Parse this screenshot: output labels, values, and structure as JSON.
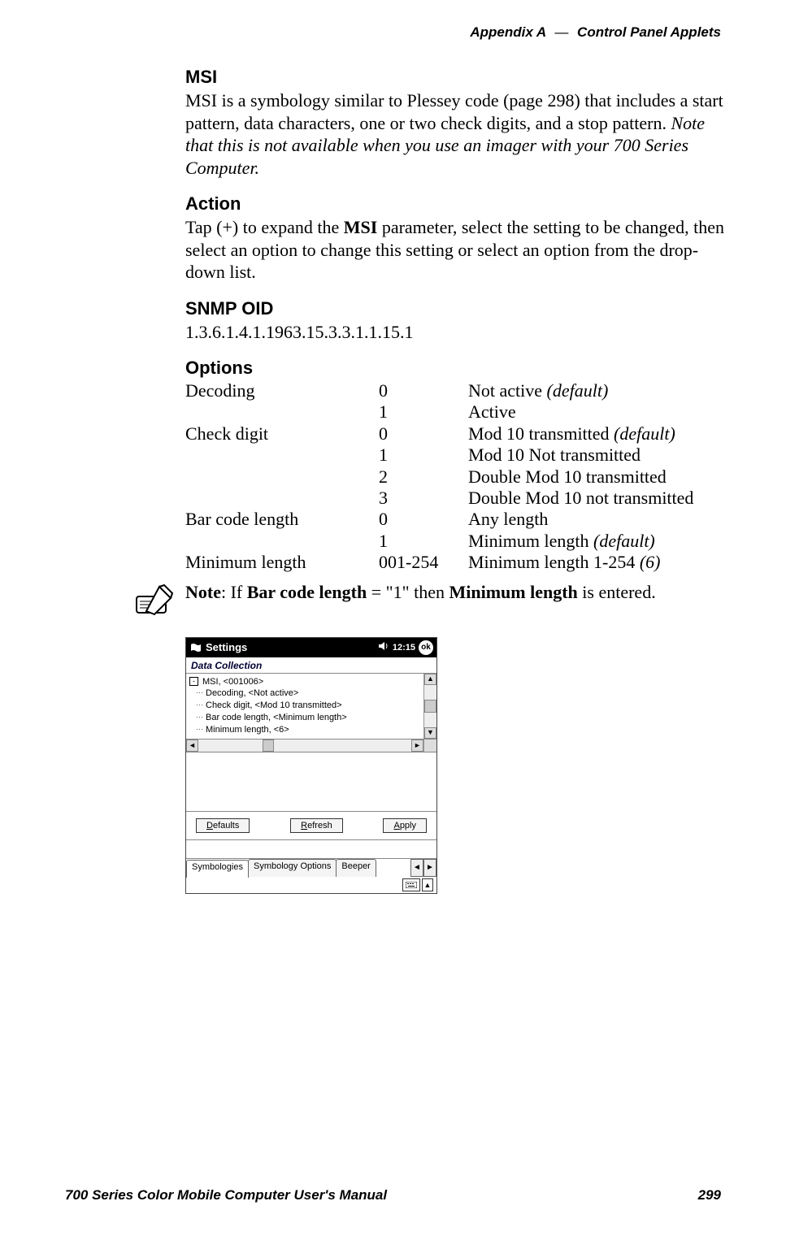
{
  "header": {
    "appendix": "Appendix A",
    "dash": "—",
    "section": "Control Panel Applets"
  },
  "sections": {
    "msi_title": "MSI",
    "msi_body_1": "MSI is a symbology similar to Plessey code (page 298) that includes a start pattern, data characters, one or two check digits, and a stop pattern. ",
    "msi_body_2_italic": "Note that this is not available when you use an imager with your 700 Series Computer.",
    "action_title": "Action",
    "action_body_a": "Tap (+) to expand the ",
    "action_body_b_bold": "MSI",
    "action_body_c": " parameter, select the setting to be changed, then select an option to change this setting or select an option from the drop-down list.",
    "snmp_title": "SNMP OID",
    "snmp_oid": "1.3.6.1.4.1.1963.15.3.3.1.1.15.1",
    "options_title": "Options"
  },
  "options": {
    "rows": [
      {
        "c1": "Decoding",
        "c2": "0",
        "c3a": "Not active ",
        "c3b_italic": "(default)"
      },
      {
        "c1": "",
        "c2": "1",
        "c3a": "Active",
        "c3b_italic": ""
      },
      {
        "c1": "Check digit",
        "c2": "0",
        "c3a": "Mod 10 transmitted ",
        "c3b_italic": "(default)"
      },
      {
        "c1": "",
        "c2": "1",
        "c3a": "Mod 10 Not transmitted",
        "c3b_italic": ""
      },
      {
        "c1": "",
        "c2": "2",
        "c3a": "Double Mod 10 transmitted",
        "c3b_italic": ""
      },
      {
        "c1": "",
        "c2": "3",
        "c3a": "Double Mod 10 not transmitted",
        "c3b_italic": ""
      },
      {
        "c1": "Bar code length",
        "c2": "0",
        "c3a": "Any length",
        "c3b_italic": ""
      },
      {
        "c1": "",
        "c2": "1",
        "c3a": "Minimum length ",
        "c3b_italic": "(default)"
      },
      {
        "c1": "Minimum length",
        "c2": "001-254",
        "c3a": "Minimum length 1-254 ",
        "c3b_italic": "(6)"
      }
    ]
  },
  "note": {
    "a": "Note",
    "b": ": If ",
    "c_bold": "Bar code length",
    "d": " = \"1\" then ",
    "e_bold": "Minimum length",
    "f": " is entered."
  },
  "screenshot": {
    "titlebar": {
      "title": "Settings",
      "time": "12:15",
      "ok": "ok"
    },
    "subtitle": "Data Collection",
    "tree": {
      "root": "MSI, <001006>",
      "items": [
        "Decoding, <Not active>",
        "Check digit, <Mod 10 transmitted>",
        "Bar code length, <Minimum length>",
        "Minimum length, <6>"
      ]
    },
    "buttons": {
      "defaults": "Defaults",
      "refresh": "Refresh",
      "apply": "Apply",
      "defaults_u": "D",
      "refresh_u": "R",
      "apply_u": "A",
      "defaults_rest": "efaults",
      "refresh_rest": "efresh",
      "apply_rest": "pply"
    },
    "tabs": {
      "t1": "Symbologies",
      "t2": "Symbology Options",
      "t3": "Beeper"
    }
  },
  "footer": {
    "left": "700 Series Color Mobile Computer User's Manual",
    "right": "299"
  }
}
